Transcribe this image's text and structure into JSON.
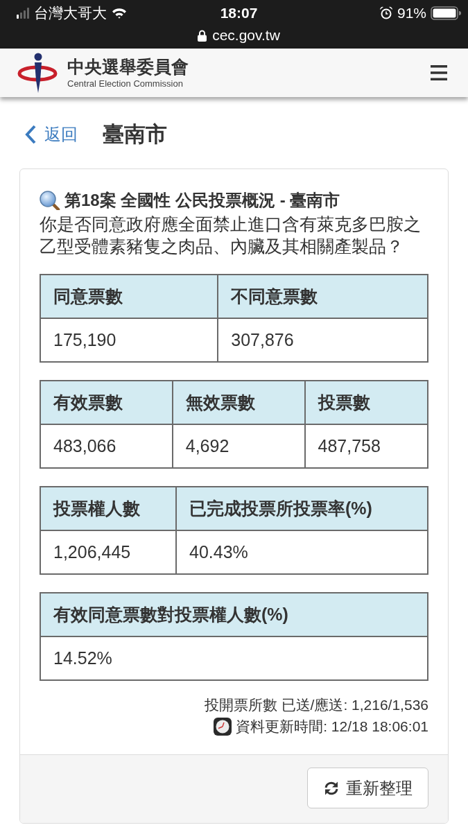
{
  "status_bar": {
    "carrier": "台灣大哥大",
    "time": "18:07",
    "battery": "91%",
    "url": "cec.gov.tw"
  },
  "header": {
    "title": "中央選舉委員會",
    "subtitle": "Central Election Commission"
  },
  "nav": {
    "back": "返回",
    "title": "臺南市"
  },
  "card": {
    "title": "第18案 全國性 公民投票概況 - 臺南市",
    "question": "你是否同意政府應全面禁止進口含有萊克多巴胺之乙型受體素豬隻之肉品、內臟及其相關產製品？",
    "tables": [
      {
        "columns": [
          "同意票數",
          "不同意票數"
        ],
        "rows": [
          [
            "175,190",
            "307,876"
          ]
        ]
      },
      {
        "columns": [
          "有效票數",
          "無效票數",
          "投票數"
        ],
        "rows": [
          [
            "483,066",
            "4,692",
            "487,758"
          ]
        ]
      },
      {
        "columns": [
          "投票權人數",
          "已完成投票所投票率(%)"
        ],
        "rows": [
          [
            "1,206,445",
            "40.43%"
          ]
        ]
      },
      {
        "columns": [
          "有效同意票數對投票權人數(%)"
        ],
        "rows": [
          [
            "14.52%"
          ]
        ]
      }
    ],
    "polling_stations": "投開票所數 已送/應送: 1,216/1,536",
    "updated": "資料更新時間: 12/18 18:06:01",
    "refresh_button": "重新整理"
  }
}
